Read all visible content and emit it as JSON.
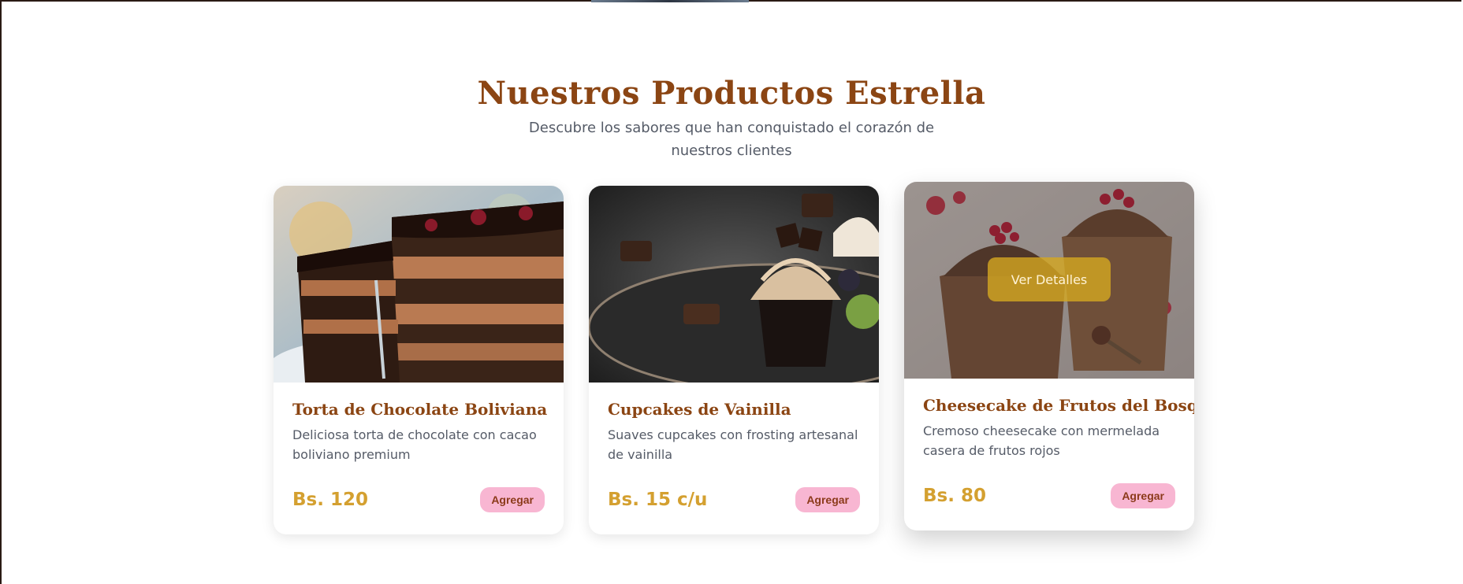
{
  "section": {
    "title": "Nuestros Productos Estrella",
    "subtitle": "Descubre los sabores que han conquistado el corazón de nuestros clientes"
  },
  "products": [
    {
      "name": "Torta de Chocolate Boliviana",
      "description": "Deliciosa torta de chocolate con cacao boliviano premium",
      "price": "Bs. 120",
      "add_label": "Agregar",
      "image": "chocolate-cake-photo"
    },
    {
      "name": "Cupcakes de Vainilla",
      "description": "Suaves cupcakes con frosting artesanal de vainilla",
      "price": "Bs. 15 c/u",
      "add_label": "Agregar",
      "image": "vanilla-cupcake-photo"
    },
    {
      "name": "Cheesecake de Frutos del Bosque",
      "description": "Cremoso cheesecake con mermelada casera de frutos rojos",
      "price": "Bs. 80",
      "add_label": "Agregar",
      "details_label": "Ver Detalles",
      "image": "berry-cheesecake-cups-photo"
    }
  ],
  "colors": {
    "title": "#8b4513",
    "price": "#d4a030",
    "add_button": "#f8b6d2",
    "details_button": "#d4a820",
    "body_text": "#555b67"
  }
}
